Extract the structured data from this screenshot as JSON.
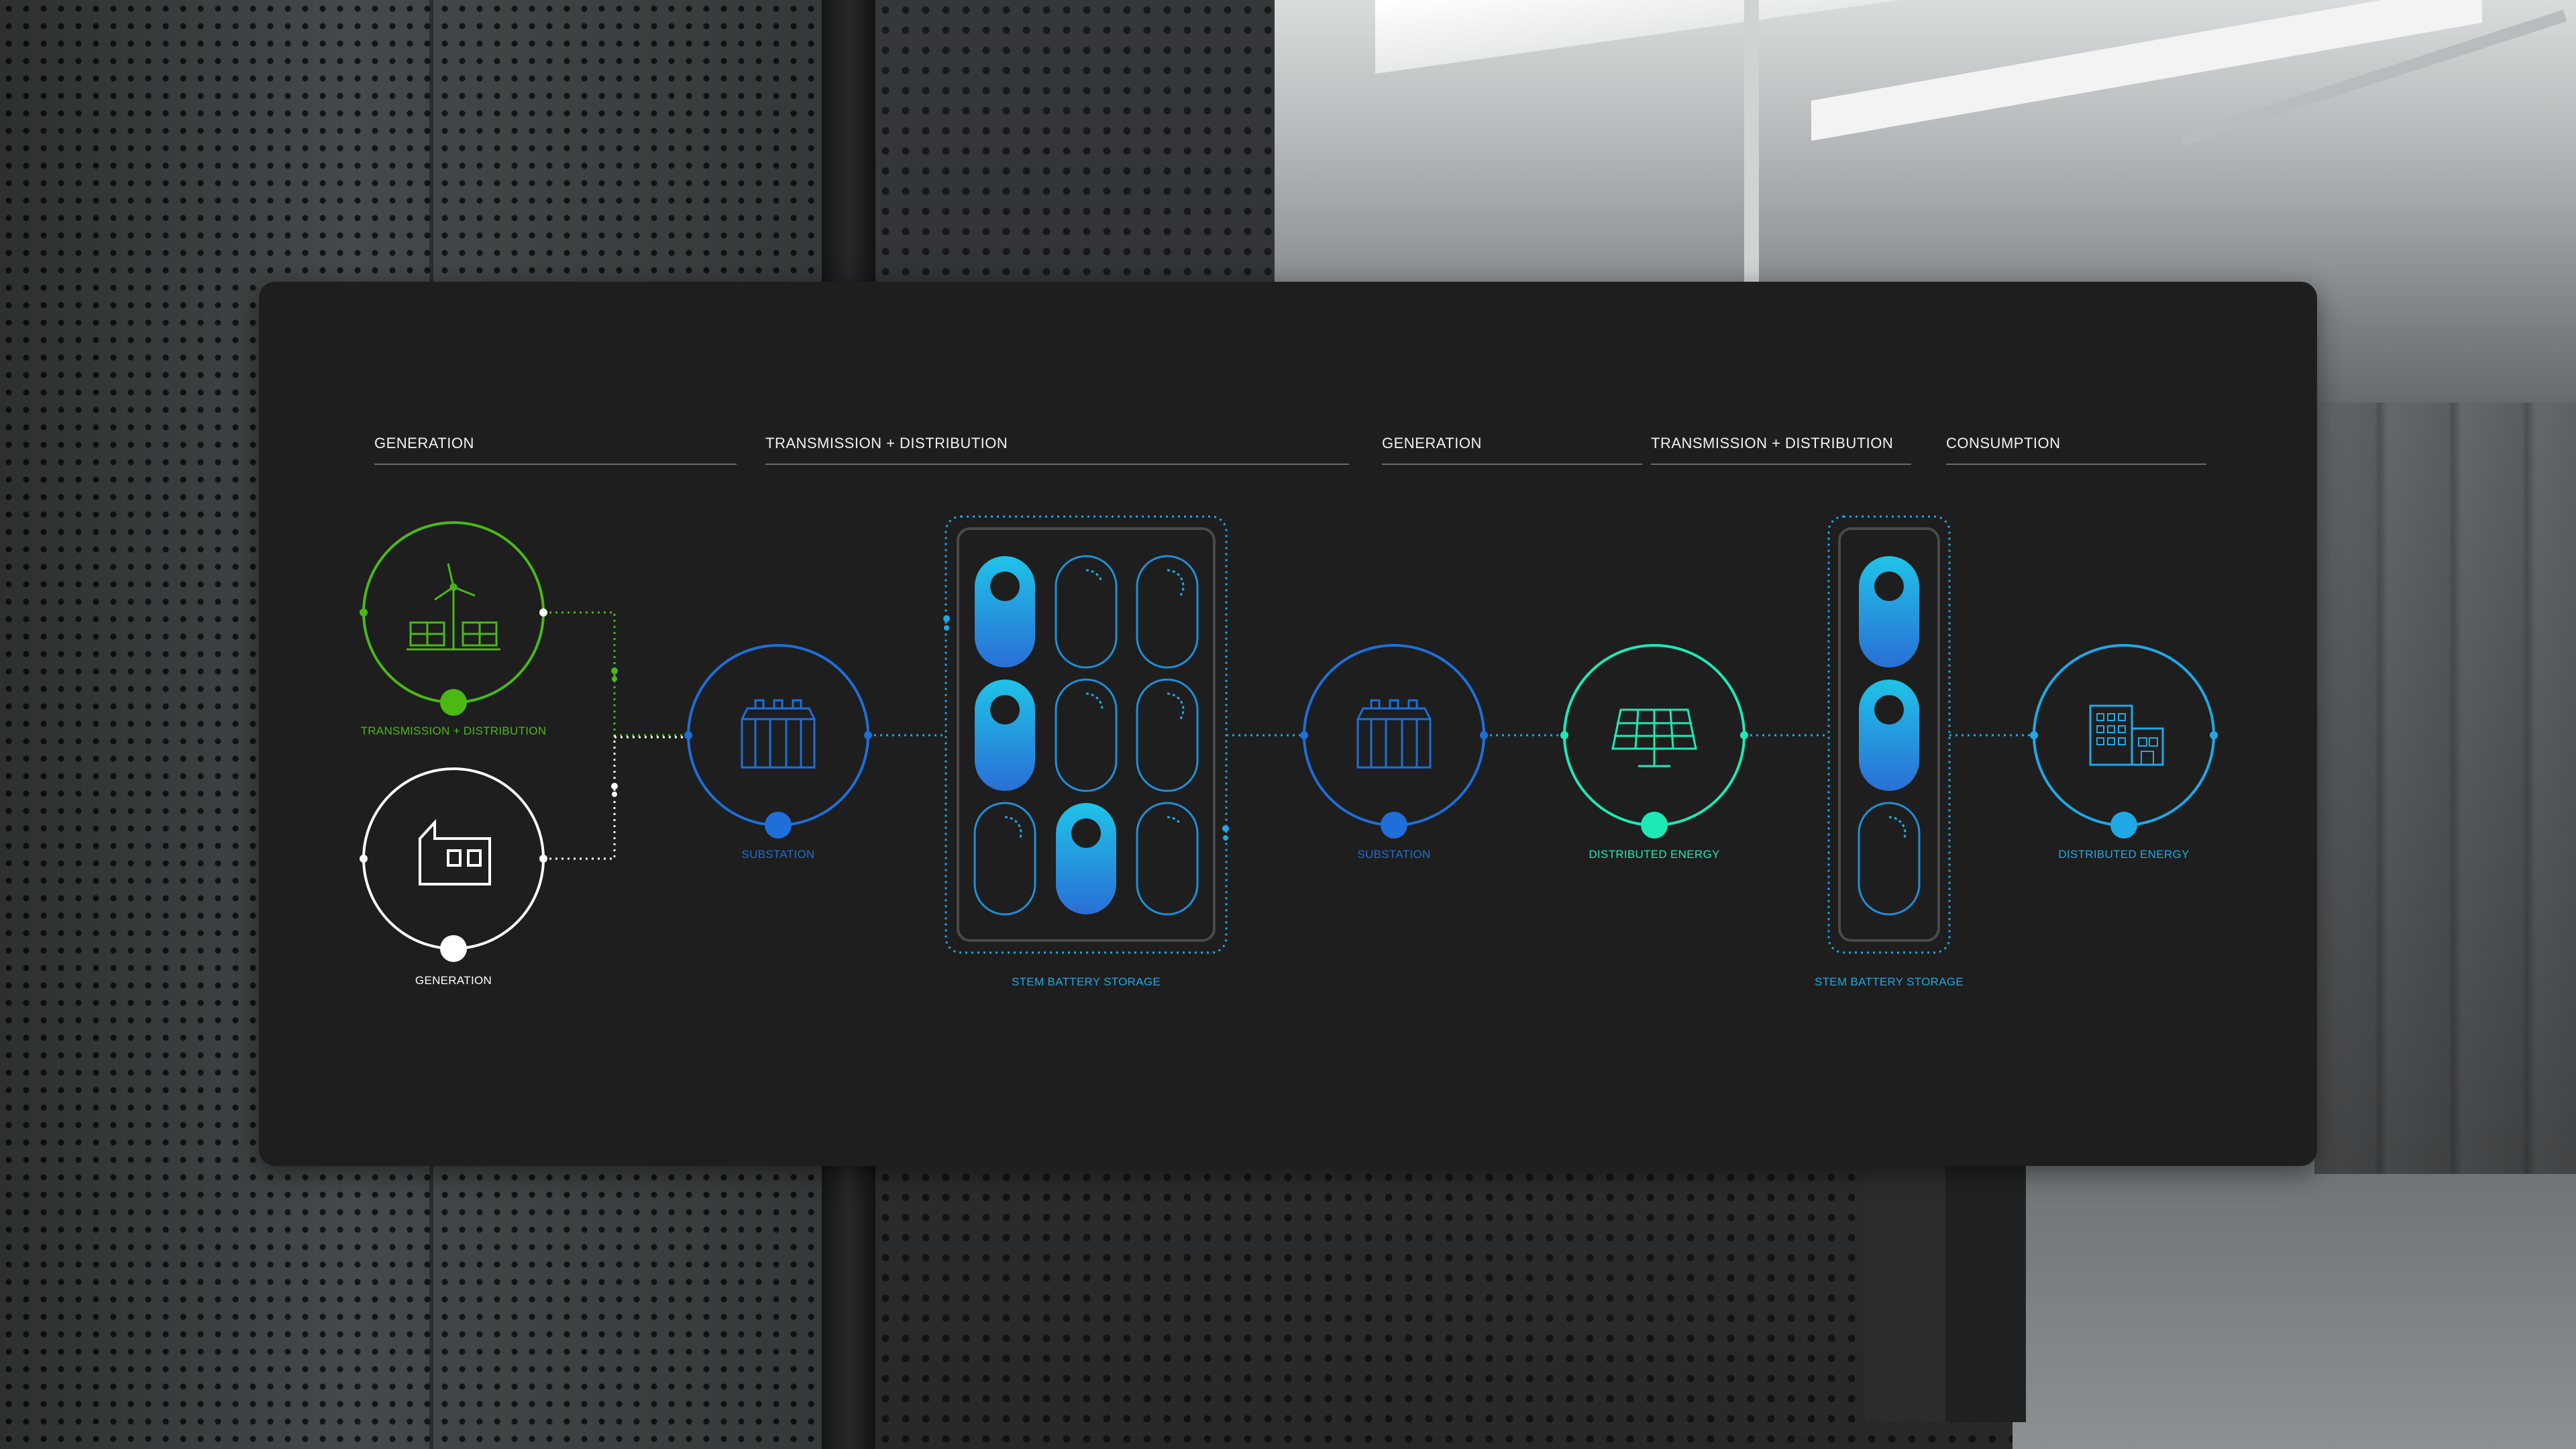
{
  "stages": [
    {
      "title": "GENERATION"
    },
    {
      "title": "TRANSMISSION + DISTRIBUTION"
    },
    {
      "title": "GENERATION"
    },
    {
      "title": "TRANSMISSION + DISTRIBUTION"
    },
    {
      "title": "CONSUMPTION"
    }
  ],
  "nodes": {
    "renewable": {
      "label": "TRANSMISSION + DISTRIBUTION",
      "icon": "wind-solar-icon",
      "color": "#4cb814"
    },
    "plant": {
      "label": "GENERATION",
      "icon": "factory-icon",
      "color": "#ffffff"
    },
    "substation_1": {
      "label": "SUBSTATION",
      "icon": "substation-icon",
      "color": "#1e6fd9"
    },
    "storage_1": {
      "label": "STEM BATTERY STORAGE",
      "icon": "battery-rack-icon",
      "color": "#1ea9e6"
    },
    "substation_2": {
      "label": "SUBSTATION",
      "icon": "substation-icon",
      "color": "#1e6fd9"
    },
    "distributed": {
      "label": "DISTRIBUTED ENERGY",
      "icon": "solar-panel-icon",
      "color": "#1de9b6"
    },
    "storage_2": {
      "label": "STEM BATTERY STORAGE",
      "icon": "battery-rack-icon",
      "color": "#1ea9e6"
    },
    "consumer": {
      "label": "DISTRIBUTED ENERGY",
      "icon": "building-icon",
      "color": "#1ea9e6"
    }
  },
  "storage_1_cells": [
    1,
    0.2,
    0.35,
    1,
    0.25,
    0.35,
    0.3,
    1,
    0.15
  ],
  "storage_2_cells": [
    1,
    1,
    0.3
  ],
  "colors": {
    "panel": "#1e1e1e",
    "green": "#4cb814",
    "blue": "#1e6fd9",
    "cyan": "#1ea9e6",
    "teal": "#1de9b6",
    "white": "#ffffff"
  }
}
